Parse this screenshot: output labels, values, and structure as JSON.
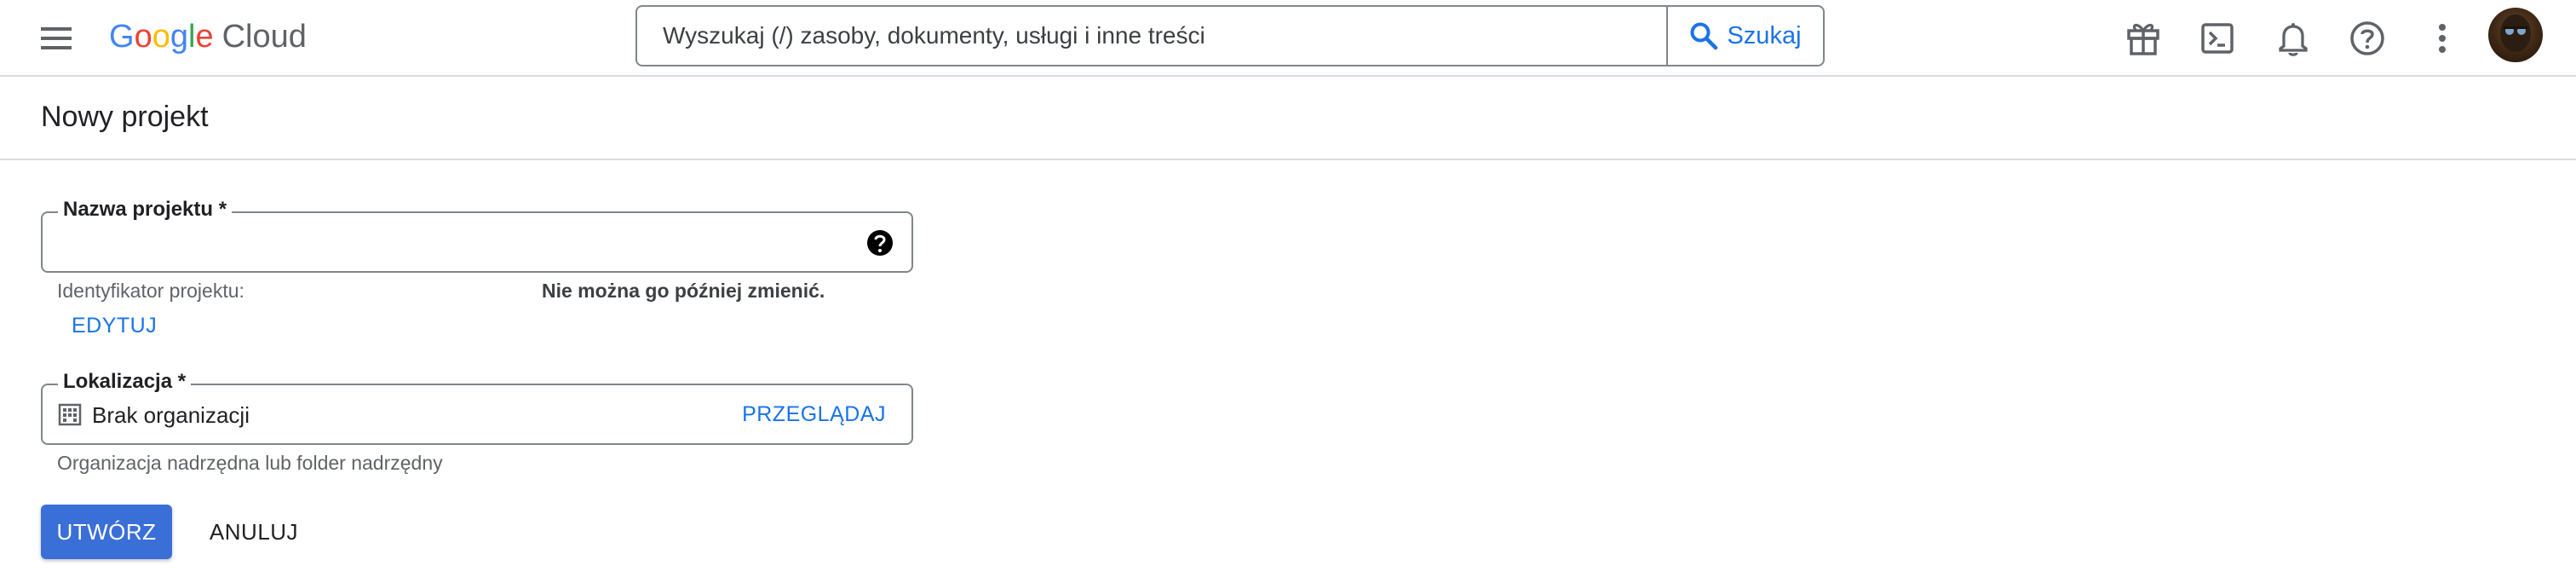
{
  "header": {
    "logo": {
      "google": [
        "G",
        "o",
        "o",
        "g",
        "l",
        "e"
      ],
      "product": "Cloud"
    },
    "search": {
      "placeholder": "Wyszukaj (/) zasoby, dokumenty, usługi i inne treści",
      "button_label": "Szukaj"
    },
    "icons": [
      "gift-icon",
      "terminal-icon",
      "notifications-icon",
      "help-icon",
      "more-vert-icon"
    ]
  },
  "page": {
    "title": "Nowy projekt"
  },
  "form": {
    "project_name": {
      "label": "Nazwa projektu *",
      "value": ""
    },
    "project_id_hint": "Identyfikator projektu:",
    "project_id_notice": "Nie można go później zmienić.",
    "edit_label": "EDYTUJ",
    "location": {
      "label": "Lokalizacja *",
      "value": "Brak organizacji",
      "browse_label": "PRZEGLĄDAJ",
      "hint": "Organizacja nadrzędna lub folder nadrzędny"
    },
    "create_label": "UTWÓRZ",
    "cancel_label": "ANULUJ"
  },
  "colors": {
    "accent": "#1a73e8",
    "primary_button": "#3b6fd8",
    "border": "#80868b",
    "divider": "#dadce0"
  }
}
